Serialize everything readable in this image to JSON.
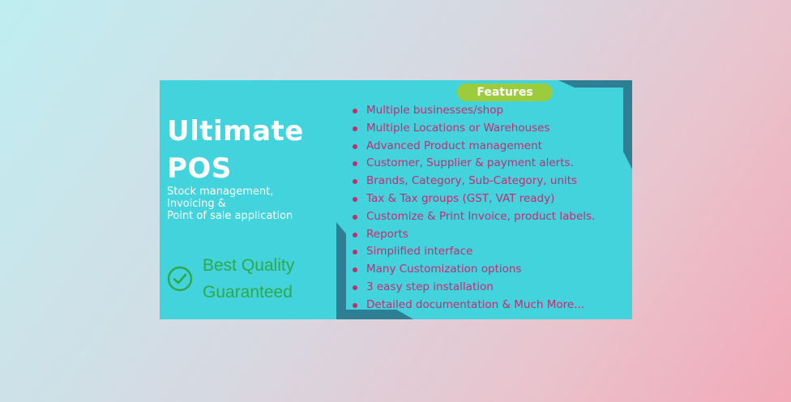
{
  "banner": {
    "title_line1": "Ultimate",
    "title_line2": "POS",
    "subtitle_lines": [
      "Stock management,",
      "Invoicing &",
      "Point of sale application"
    ],
    "quality_line1": "Best Quality",
    "quality_line2": "Guaranteed",
    "quality_icon": "check-circle-icon",
    "features_label": "Features",
    "features": [
      "Multiple businesses/shop",
      "Multiple Locations or Warehouses",
      "Advanced Product management",
      "Customer, Supplier & payment alerts.",
      "Brands, Category, Sub-Category, units",
      "Tax & Tax groups (GST, VAT ready)",
      "Customize & Print Invoice, product labels.",
      "Reports",
      "Simplified interface",
      "Many Customization options",
      "3 easy step installation",
      "Detailed documentation & Much More..."
    ],
    "colors": {
      "banner_bg": "#43d3dd",
      "accent_frame": "#2f7f94",
      "features_text": "#c42c6f",
      "badge_bg": "#9ccc3c",
      "quality_green": "#2fa84a"
    }
  }
}
